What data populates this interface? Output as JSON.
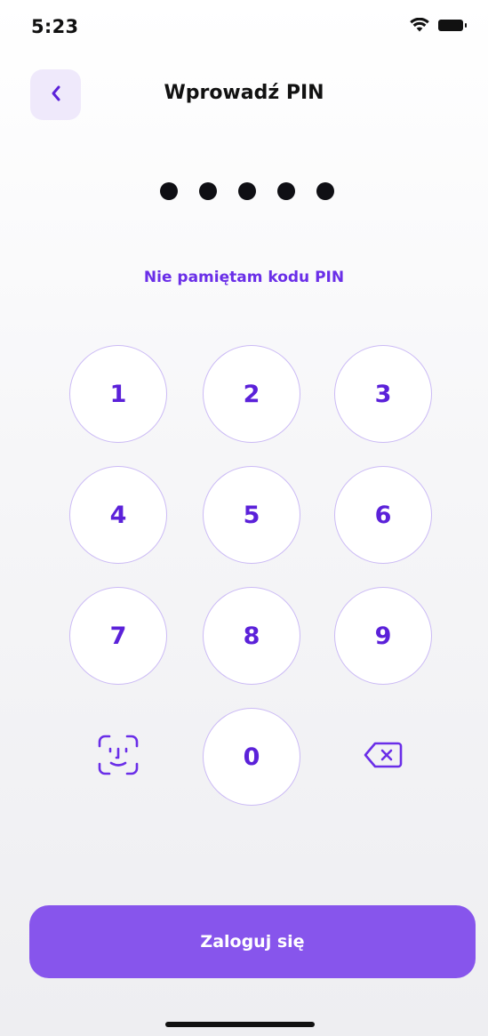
{
  "status_bar": {
    "time": "5:23",
    "icons": [
      "wifi-icon",
      "battery-icon"
    ]
  },
  "header": {
    "title": "Wprowadź PIN",
    "back_icon": "chevron-left-icon"
  },
  "pin": {
    "entered_digits": 5
  },
  "forgot_link": "Nie pamiętam kodu PIN",
  "keypad": {
    "keys": [
      "1",
      "2",
      "3",
      "4",
      "5",
      "6",
      "7",
      "8",
      "9",
      "0"
    ],
    "biometric_icon": "face-id-icon",
    "delete_icon": "backspace-icon"
  },
  "login_button": "Zaloguj się",
  "colors": {
    "accent": "#8755ec",
    "accent_text": "#6a2ee8",
    "key_text": "#5b21d9",
    "key_border": "#cbbaf5",
    "back_bg": "#efe9fb"
  }
}
